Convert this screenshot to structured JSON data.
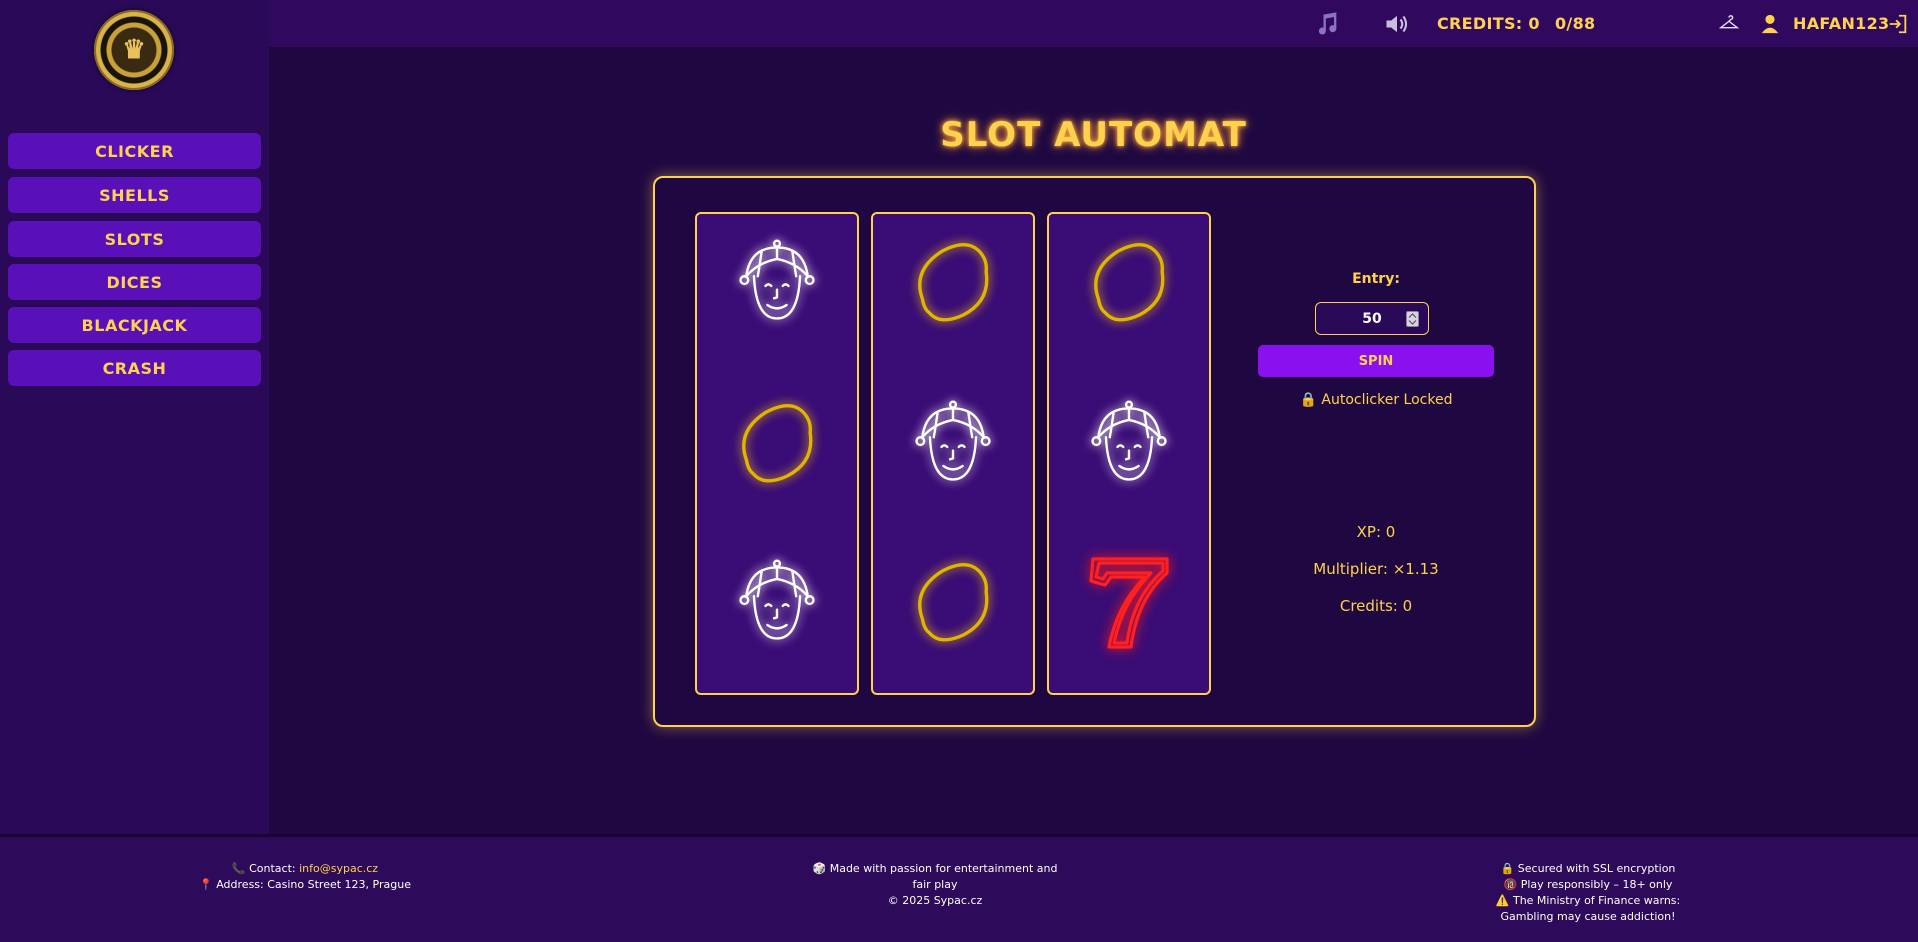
{
  "sidebar": {
    "items": [
      {
        "label": "CLICKER"
      },
      {
        "label": "SHELLS"
      },
      {
        "label": "SLOTS"
      },
      {
        "label": "DICES"
      },
      {
        "label": "BLACKJACK"
      },
      {
        "label": "CRASH"
      }
    ]
  },
  "header": {
    "music_icon": "music-note-icon",
    "sound_icon": "speaker-icon",
    "credits_label": "CREDITS: 0",
    "progress": "0/88",
    "wardrobe_icon": "hanger-icon",
    "user_icon": "user-icon",
    "username": "HAFAN123",
    "logout_icon": "logout-icon"
  },
  "main": {
    "title": "SLOT AUTOMAT",
    "reels": [
      [
        "jester",
        "lemon",
        "jester"
      ],
      [
        "lemon",
        "jester",
        "lemon"
      ],
      [
        "lemon",
        "jester",
        "seven"
      ]
    ],
    "entry_label": "Entry:",
    "entry_value": "50",
    "spin_label": "SPIN",
    "autoclicker": "Autoclicker Locked",
    "xp": "XP: 0",
    "multiplier": "Multiplier: ×1.13",
    "credits": "Credits: 0"
  },
  "footer": {
    "contact_prefix": "Contact: ",
    "contact_email": "info@sypac.cz",
    "address": "Address: Casino Street 123, Prague",
    "made_with": "Made with passion for entertainment and fair play",
    "copyright": "© 2025 Sypac.cz",
    "ssl": "Secured with SSL encryption",
    "responsible": "Play responsibly – 18+ only",
    "warning": "The Ministry of Finance warns: Gambling may cause addiction!"
  },
  "colors": {
    "accent": "#ffd24d",
    "button": "#5a10b8",
    "spin": "#8a10f0",
    "background": "#1f0841"
  }
}
